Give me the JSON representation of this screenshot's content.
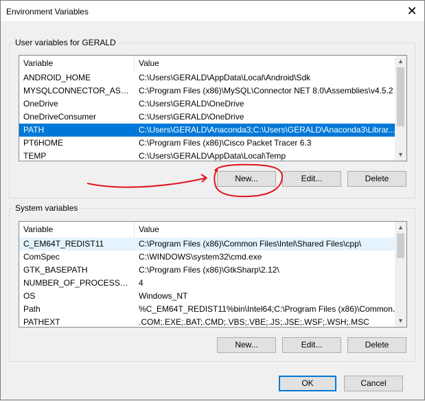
{
  "window": {
    "title": "Environment Variables",
    "close_glyph": "✕"
  },
  "user_vars": {
    "group_label": "User variables for GERALD",
    "headers": {
      "variable": "Variable",
      "value": "Value"
    },
    "rows": [
      {
        "variable": "ANDROID_HOME",
        "value": "C:\\Users\\GERALD\\AppData\\Local\\Android\\Sdk"
      },
      {
        "variable": "MYSQLCONNECTOR_ASSE...",
        "value": "C:\\Program Files (x86)\\MySQL\\Connector NET 8.0\\Assemblies\\v4.5.2"
      },
      {
        "variable": "OneDrive",
        "value": "C:\\Users\\GERALD\\OneDrive"
      },
      {
        "variable": "OneDriveConsumer",
        "value": "C:\\Users\\GERALD\\OneDrive"
      },
      {
        "variable": "PATH",
        "value": "C:\\Users\\GERALD\\Anaconda3;C:\\Users\\GERALD\\Anaconda3\\Librar..."
      },
      {
        "variable": "PT6HOME",
        "value": "C:\\Program Files (x86)\\Cisco Packet Tracer 6.3"
      },
      {
        "variable": "TEMP",
        "value": "C:\\Users\\GERALD\\AppData\\Local\\Temp"
      }
    ],
    "buttons": {
      "new": "New...",
      "edit": "Edit...",
      "delete": "Delete"
    }
  },
  "system_vars": {
    "group_label": "System variables",
    "headers": {
      "variable": "Variable",
      "value": "Value"
    },
    "rows": [
      {
        "variable": "C_EM64T_REDIST11",
        "value": "C:\\Program Files (x86)\\Common Files\\Intel\\Shared Files\\cpp\\"
      },
      {
        "variable": "ComSpec",
        "value": "C:\\WINDOWS\\system32\\cmd.exe"
      },
      {
        "variable": "GTK_BASEPATH",
        "value": "C:\\Program Files (x86)\\GtkSharp\\2.12\\"
      },
      {
        "variable": "NUMBER_OF_PROCESSORS",
        "value": "4"
      },
      {
        "variable": "OS",
        "value": "Windows_NT"
      },
      {
        "variable": "Path",
        "value": "%C_EM64T_REDIST11%bin\\Intel64;C:\\Program Files (x86)\\Common..."
      },
      {
        "variable": "PATHEXT",
        "value": ".COM;.EXE;.BAT;.CMD;.VBS;.VBE;.JS;.JSE;.WSF;.WSH;.MSC"
      }
    ],
    "buttons": {
      "new": "New...",
      "edit": "Edit...",
      "delete": "Delete"
    }
  },
  "dialog_buttons": {
    "ok": "OK",
    "cancel": "Cancel"
  },
  "selected_user_row": 4,
  "hover_system_row": 0,
  "colors": {
    "selection": "#0078d7",
    "hover": "#e5f3ff",
    "annotation": "#e0131a"
  }
}
